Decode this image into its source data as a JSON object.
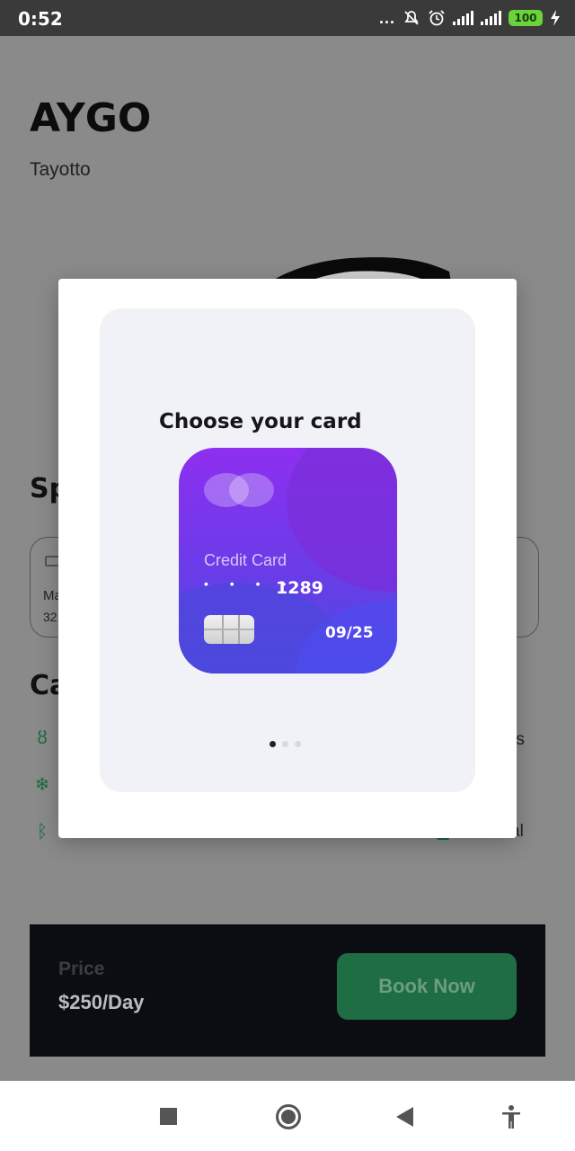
{
  "status_bar": {
    "time": "0:52",
    "dots": "...",
    "battery": "100"
  },
  "page": {
    "title": "AYGO",
    "subtitle": "Tayotto",
    "specs_heading": "Sp",
    "spec_card": {
      "label": "Ma",
      "value": "32"
    },
    "car_features_heading": "Ca",
    "features_right": [
      "rs",
      "al"
    ],
    "price_label": "Price",
    "price_value": "$250/Day",
    "book_button": "Book Now"
  },
  "modal": {
    "title": "Choose your card",
    "card": {
      "type_label": "Credit Card",
      "masked_digits": "• • • •",
      "last_digits": "1289",
      "expiry": "09/25"
    },
    "pager": {
      "count": 3,
      "active_index": 0
    }
  },
  "colors": {
    "accent_green": "#1f6d42",
    "card_purple": "#8e2ff0",
    "card_blue": "#4a4be2"
  },
  "icons": {
    "feature_1": "seat-icon",
    "feature_2": "snowflake-icon",
    "feature_3": "bluetooth-icon"
  }
}
